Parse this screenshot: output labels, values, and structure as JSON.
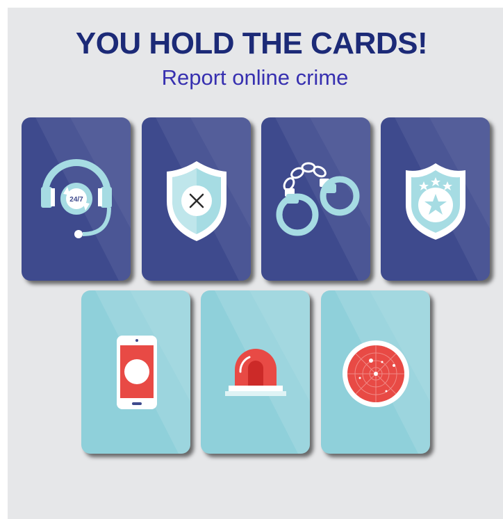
{
  "header": {
    "title": "YOU HOLD THE CARDS!",
    "subtitle": "Report online crime"
  },
  "cards": [
    {
      "icon": "headset-support-icon",
      "label": "24/7"
    },
    {
      "icon": "shield-x-icon"
    },
    {
      "icon": "handcuffs-icon"
    },
    {
      "icon": "police-badge-icon"
    },
    {
      "icon": "smartphone-icon"
    },
    {
      "icon": "siren-icon"
    },
    {
      "icon": "radar-icon"
    }
  ],
  "colors": {
    "background": "#e6e7e9",
    "title": "#1c2a77",
    "subtitle": "#3730b0",
    "card_dark": "#3e4a8d",
    "card_light": "#8fd0da",
    "icon_light": "#a6dce3",
    "icon_red": "#e84a45"
  }
}
